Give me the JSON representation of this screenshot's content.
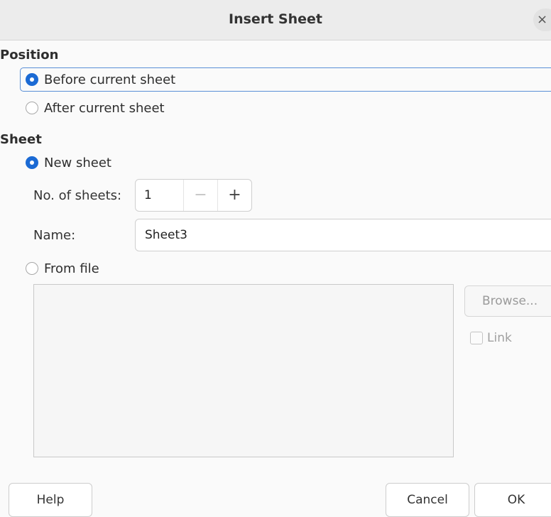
{
  "window": {
    "title": "Insert Sheet",
    "close_glyph": "×"
  },
  "position": {
    "heading": "Position",
    "before_label": "Before current sheet",
    "after_label": "After current sheet",
    "selected": "before"
  },
  "sheet": {
    "heading": "Sheet",
    "new_sheet_label": "New sheet",
    "count_label": "No. of sheets:",
    "count_value": "1",
    "minus_glyph": "−",
    "plus_glyph": "+",
    "name_label": "Name:",
    "name_value": "Sheet3",
    "from_file_label": "From file",
    "browse_label": "Browse...",
    "link_label": "Link",
    "selected": "new"
  },
  "buttons": {
    "help": "Help",
    "cancel": "Cancel",
    "ok": "OK"
  },
  "colors": {
    "accent": "#1b6ad4",
    "focus_ring": "#5a8fd6"
  }
}
